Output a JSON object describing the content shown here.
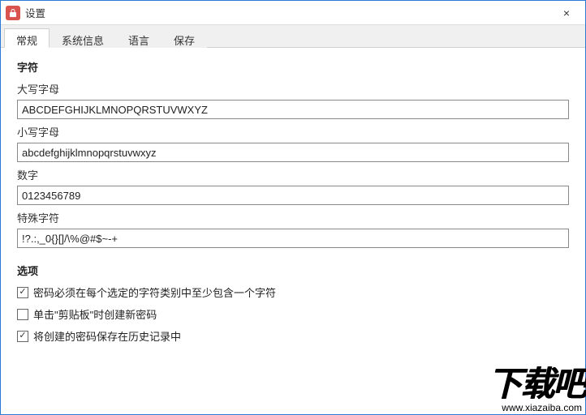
{
  "window": {
    "title": "设置",
    "close": "×"
  },
  "tabs": [
    {
      "label": "常规",
      "active": true
    },
    {
      "label": "系统信息",
      "active": false
    },
    {
      "label": "语言",
      "active": false
    },
    {
      "label": "保存",
      "active": false
    }
  ],
  "chars_section": {
    "heading": "字符",
    "uppercase_label": "大写字母",
    "uppercase_value": "ABCDEFGHIJKLMNOPQRSTUVWXYZ",
    "lowercase_label": "小写字母",
    "lowercase_value": "abcdefghijklmnopqrstuvwxyz",
    "digits_label": "数字",
    "digits_value": "0123456789",
    "special_label": "特殊字符",
    "special_value": "!?.:,_0{}[]/\\%@#$~-+"
  },
  "options_section": {
    "heading": "选项",
    "opt1_label": "密码必须在每个选定的字符类别中至少包含一个字符",
    "opt1_checked": true,
    "opt2_label": "单击\"剪贴板\"时创建新密码",
    "opt2_checked": false,
    "opt3_label": "将创建的密码保存在历史记录中",
    "opt3_checked": true
  },
  "watermark": {
    "text": "下载吧",
    "url": "www.xiazaiba.com"
  }
}
